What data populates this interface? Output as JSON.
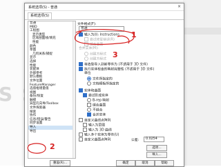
{
  "dialog": {
    "title": "系统选项(S) - 普通",
    "close_glyph": "×",
    "tab": "系统选项(S)",
    "background_logo": "S SO"
  },
  "sidebar": {
    "items": [
      {
        "label": "普通",
        "indent": 0
      },
      {
        "label": "MBD",
        "indent": 0
      },
      {
        "label": "工程图",
        "indent": 0
      },
      {
        "label": "显示类型",
        "indent": 1
      },
      {
        "label": "区域剖面线/填充",
        "indent": 1
      },
      {
        "label": "性能",
        "indent": 1
      },
      {
        "label": "颜色",
        "indent": 0
      },
      {
        "label": "草图",
        "indent": 0
      },
      {
        "label": "几何关系/捕捉",
        "indent": 1
      },
      {
        "label": "显示",
        "indent": 0
      },
      {
        "label": "选择",
        "indent": 0
      },
      {
        "label": "性能",
        "indent": 0
      },
      {
        "label": "装配体",
        "indent": 0
      },
      {
        "label": "外部参考",
        "indent": 0
      },
      {
        "label": "默认模板",
        "indent": 0
      },
      {
        "label": "文件位置",
        "indent": 0
      },
      {
        "label": "FeatureManager",
        "indent": 0
      },
      {
        "label": "选值框增量值",
        "indent": 0
      },
      {
        "label": "视图",
        "indent": 0
      },
      {
        "label": "备份/恢复",
        "indent": 0
      },
      {
        "label": "触摸",
        "indent": 0
      },
      {
        "label": "异型孔向导/Toolbox",
        "indent": 0
      },
      {
        "label": "文件探索器",
        "indent": 0
      },
      {
        "label": "搜索",
        "indent": 0
      },
      {
        "label": "协作",
        "indent": 0
      },
      {
        "label": "信息/错误/警告",
        "indent": 0
      },
      {
        "label": "同步设置",
        "indent": 0
      },
      {
        "label": "导入",
        "indent": 0,
        "selected": true
      },
      {
        "label": "导出",
        "indent": 0
      }
    ]
  },
  "panel": {
    "input_label": "文件格式(F):",
    "format_value": "普通",
    "solid_label": "如有的话",
    "checkboxes_top": [
      {
        "label": "输入为(I):  Instructions",
        "checked": true,
        "muted": false
      },
      {
        "label": "尝试修复错误(R)",
        "checked": false,
        "muted": true
      },
      {
        "label": "缝合曲面",
        "checked": false,
        "muted": true
      }
    ],
    "merge_label": "合并实体(M):",
    "radios_merge": [
      {
        "label": "创建方程式",
        "on": false,
        "muted": true
      },
      {
        "label": "创建方程式",
        "on": false,
        "muted": true
      }
    ],
    "checkbox_mid": {
      "label": "将造型导入到新零件为 (不适用于 3D 文件)",
      "checked": true
    },
    "checkbox_mid2": {
      "label": "执行实体检查的映射完整性 (不适用于 3D 文件)",
      "checked": true
    },
    "unit_label": "单位",
    "radios_unit": [
      {
        "label": "文件所指定的",
        "on": true
      },
      {
        "label": "文档模板所指定的",
        "on": false
      }
    ],
    "section2_title": "实体和曲面",
    "checkboxes_section2": [
      {
        "label": "尝试形成实体",
        "checked": true,
        "kind": "cb",
        "indent": 0
      },
      {
        "label": "B-rep 映射",
        "checked": false,
        "kind": "rb",
        "indent": 1
      },
      {
        "label": "缝合曲面",
        "checked": false,
        "kind": "cb",
        "indent": 1
      },
      {
        "label": "不缝合",
        "checked": false,
        "kind": "rb",
        "indent": 1
      },
      {
        "label": "合并实体",
        "checked": true,
        "kind": "cb",
        "indent": 1
      }
    ],
    "checkboxes_bottom": [
      {
        "label": "自定义曲线点阵列",
        "checked": false
      },
      {
        "label": "输入为草图",
        "checked": false
      },
      {
        "label": "输入为 3D 曲线",
        "checked": false
      },
      {
        "label": "输入多个实体为零件(U)",
        "checked": false
      },
      {
        "label": "自定义曲面点阵列",
        "checked": false
      }
    ],
    "tolerance_label": "公差:",
    "tolerance_value": "0.0254",
    "options_button": "选项...",
    "import_button": "导入..."
  },
  "footer": {
    "reset_button": "重设(R)...",
    "ok_button": "确定",
    "cancel_button": "取消",
    "help_button": "帮助"
  },
  "annotations": {
    "n1": "1",
    "n2": "2",
    "n3": "3",
    "color": "#d62020"
  },
  "colors": {
    "selection": "#cfe3f6",
    "accent": "#2f6fc8",
    "annotation": "#d62020"
  }
}
